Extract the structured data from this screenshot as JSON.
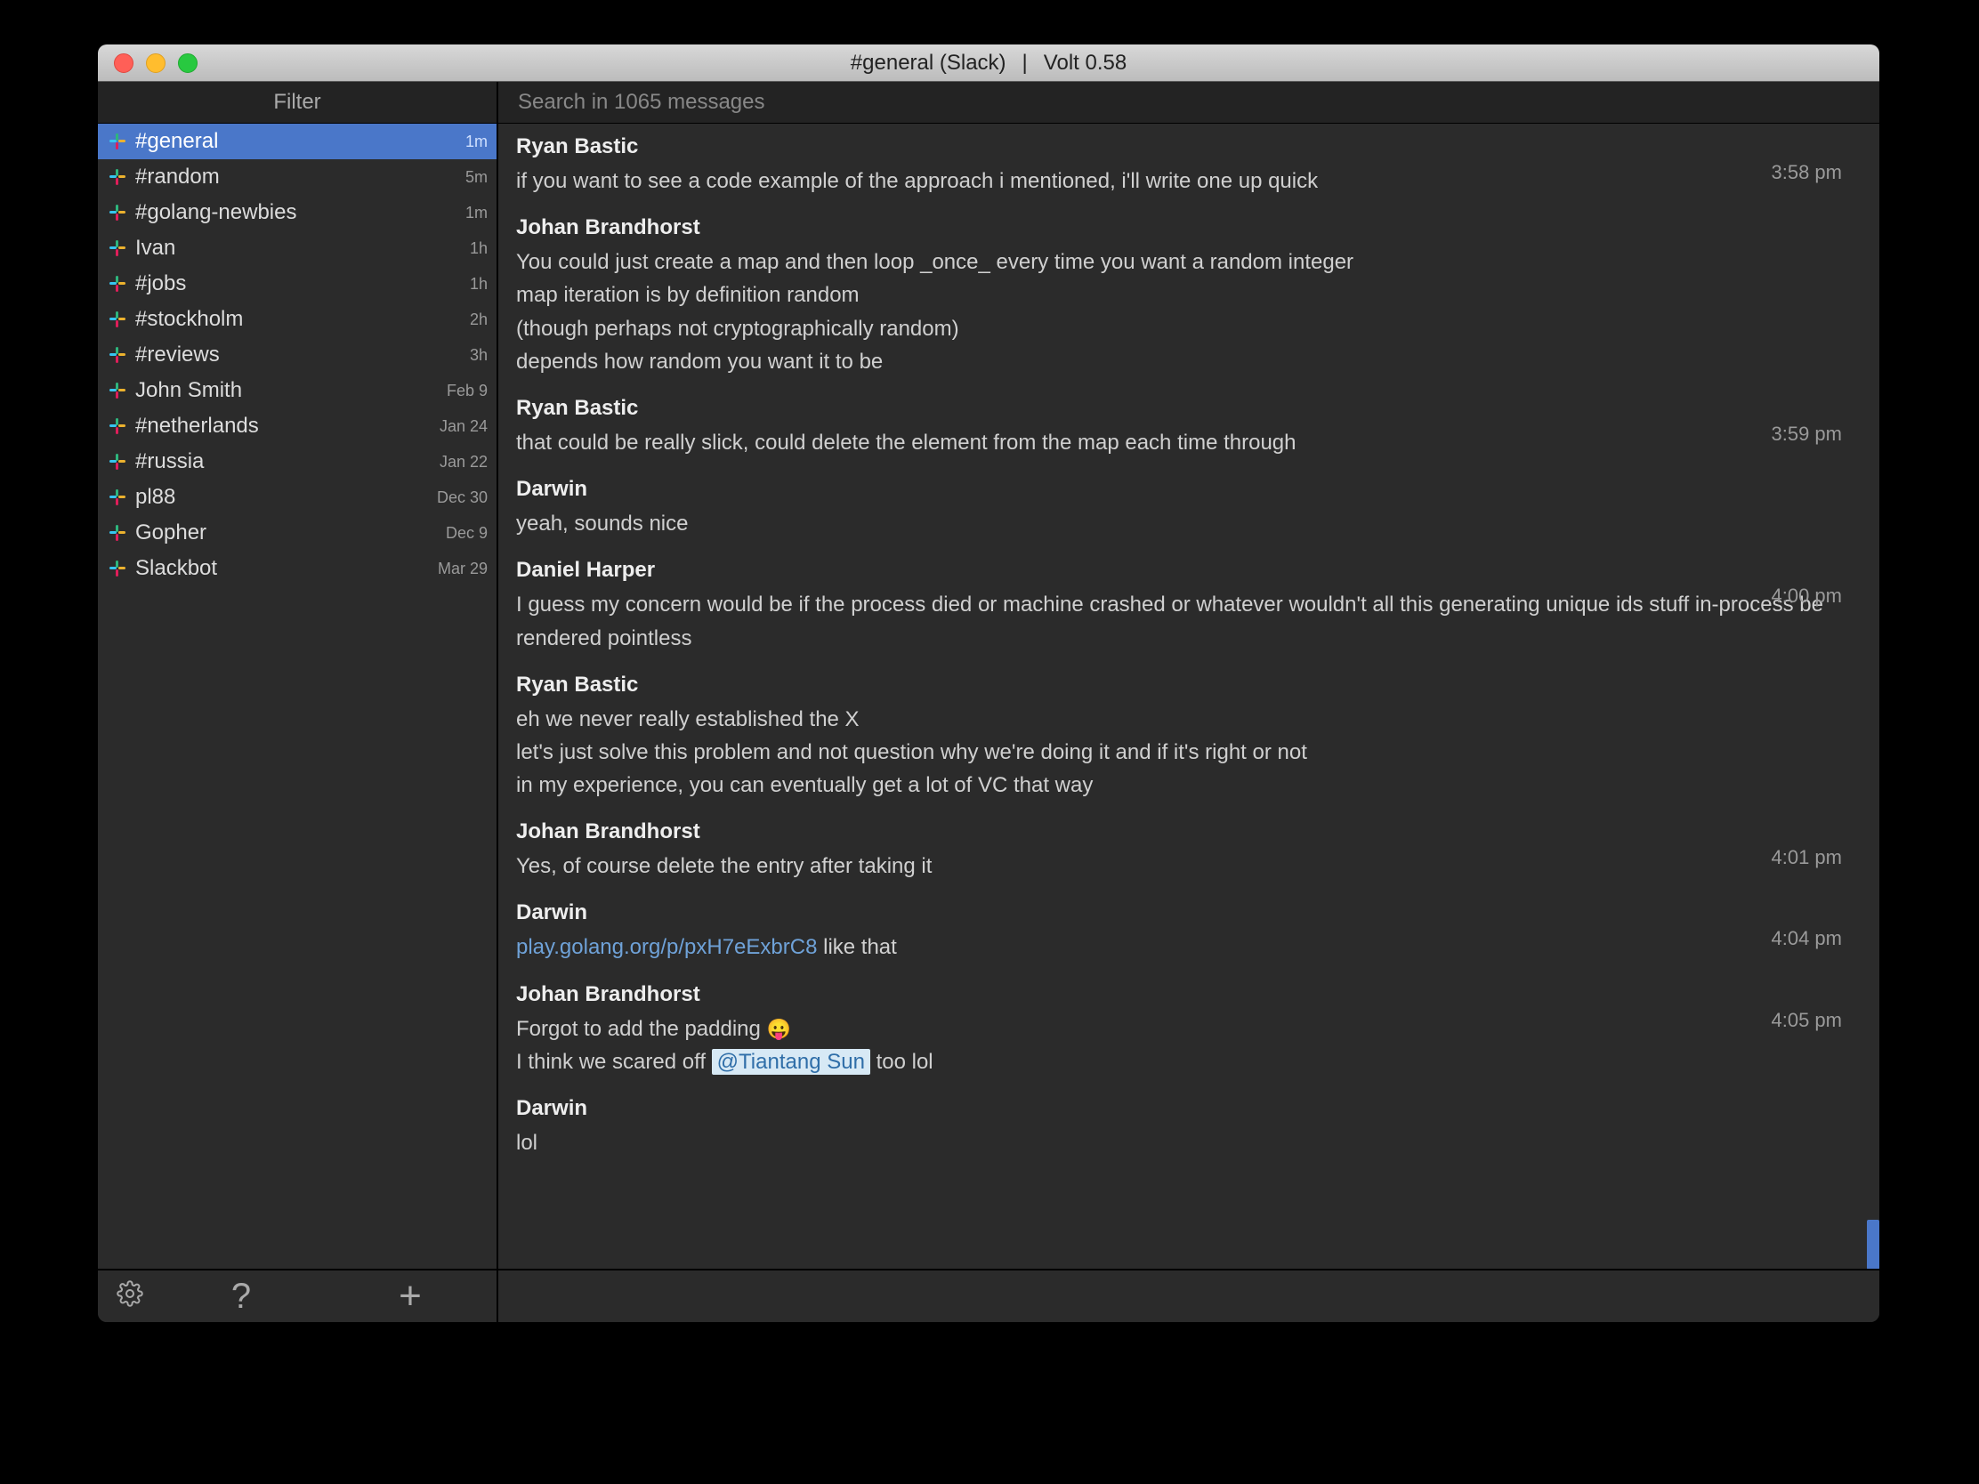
{
  "window": {
    "title_channel": "#general (Slack)",
    "title_sep": "|",
    "title_app": "Volt 0.58"
  },
  "toolbar": {
    "filter_label": "Filter",
    "search_placeholder": "Search in 1065 messages"
  },
  "sidebar": {
    "items": [
      {
        "name": "#general",
        "ts": "1m",
        "selected": true,
        "icon": "slack"
      },
      {
        "name": "#random",
        "ts": "5m",
        "icon": "slack"
      },
      {
        "name": "#golang-newbies",
        "ts": "1m",
        "icon": "slack"
      },
      {
        "name": "Ivan",
        "ts": "1h",
        "icon": "slack"
      },
      {
        "name": "#jobs",
        "ts": "1h",
        "icon": "slack"
      },
      {
        "name": "#stockholm",
        "ts": "2h",
        "icon": "slack"
      },
      {
        "name": "#reviews",
        "ts": "3h",
        "icon": "slack"
      },
      {
        "name": "John Smith",
        "ts": "Feb 9",
        "icon": "slack"
      },
      {
        "name": "#netherlands",
        "ts": "Jan 24",
        "icon": "slack"
      },
      {
        "name": "#russia",
        "ts": "Jan 22",
        "icon": "slack"
      },
      {
        "name": "pl88",
        "ts": "Dec 30",
        "icon": "slack"
      },
      {
        "name": "Gopher",
        "ts": "Dec 9",
        "icon": "slack"
      },
      {
        "name": "Slackbot",
        "ts": "Mar 29",
        "icon": "slack"
      }
    ]
  },
  "messages": [
    {
      "author": "Ryan Bastic",
      "time": "3:58 pm",
      "lines": [
        {
          "text": "if you want to see a code example of the approach i mentioned, i'll write one up quick"
        }
      ]
    },
    {
      "author": "Johan Brandhorst",
      "lines": [
        {
          "text": "You could just create a map and then loop _once_ every time you want a random integer"
        },
        {
          "text": "map iteration is by definition random"
        },
        {
          "text": "(though perhaps not cryptographically random)"
        },
        {
          "text": "depends how random you want it to be"
        }
      ]
    },
    {
      "author": "Ryan Bastic",
      "time": "3:59 pm",
      "lines": [
        {
          "text": "that could be really slick, could delete the element from the map each time through"
        }
      ]
    },
    {
      "author": "Darwin",
      "lines": [
        {
          "text": "yeah, sounds nice"
        }
      ]
    },
    {
      "author": "Daniel Harper",
      "time": "4:00 pm",
      "lines": [
        {
          "text": "I guess my concern would be if the process died or machine crashed or whatever wouldn't all this generating unique ids stuff in-process be rendered pointless"
        }
      ]
    },
    {
      "author": "Ryan Bastic",
      "lines": [
        {
          "text": "eh we never really established the X"
        },
        {
          "text": "let's just solve this problem and not question why we're doing it and if it's right or not"
        },
        {
          "text": "in my experience, you can eventually get a lot of VC that way"
        }
      ]
    },
    {
      "author": "Johan Brandhorst",
      "time": "4:01 pm",
      "lines": [
        {
          "text": "Yes, of course delete the entry after taking it"
        }
      ]
    },
    {
      "author": "Darwin",
      "time": "4:04 pm",
      "lines": [
        {
          "link": "play.golang.org/p/pxH7eExbrC8",
          "tail": "   like that"
        }
      ]
    },
    {
      "author": "Johan Brandhorst",
      "time": "4:05 pm",
      "lines": [
        {
          "text": "Forgot to add the padding ",
          "emoji": "😛"
        },
        {
          "prefix": "I think we scared off ",
          "mention": "@Tiantang Sun",
          "suffix": "   too lol"
        }
      ]
    },
    {
      "author": "Darwin",
      "lines": [
        {
          "text": "lol"
        }
      ]
    }
  ],
  "footer": {
    "settings": "⚙",
    "help": "?",
    "add": "+"
  }
}
